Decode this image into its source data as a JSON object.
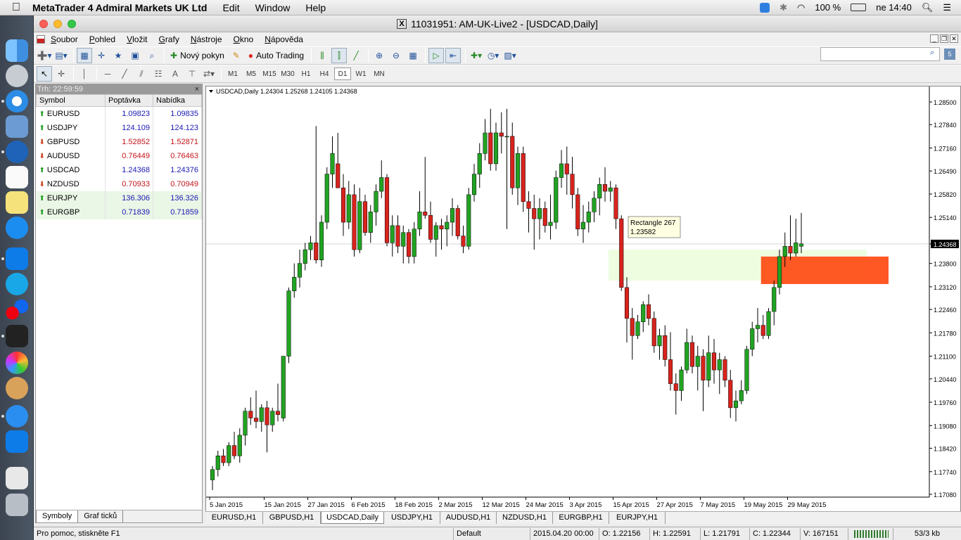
{
  "menubar": {
    "app_name": "MetaTrader 4 Admiral Markets UK Ltd",
    "items": [
      "Edit",
      "Window",
      "Help"
    ],
    "battery": "100 %",
    "clock": "ne 14:40"
  },
  "window": {
    "title": "11031951: AM-UK-Live2 - [USDCAD,Daily]"
  },
  "menu": {
    "items": [
      {
        "u": "S",
        "rest": "oubor"
      },
      {
        "u": "P",
        "rest": "ohled"
      },
      {
        "u": "V",
        "rest": "ložit"
      },
      {
        "u": "G",
        "rest": "rafy"
      },
      {
        "u": "N",
        "rest": "ástroje"
      },
      {
        "u": "O",
        "rest": "kno"
      },
      {
        "u": "N",
        "rest": "ápověda"
      }
    ]
  },
  "toolbar": {
    "new_order": "Nový pokyn",
    "auto_trading": "Auto Trading",
    "search_placeholder": "",
    "search_badge": "5"
  },
  "drawing_toolbar": {
    "timeframes": [
      "M1",
      "M5",
      "M15",
      "M30",
      "H1",
      "H4",
      "D1",
      "W1",
      "MN"
    ],
    "active": "D1",
    "text_tool": "A"
  },
  "market_watch": {
    "header": "Trh: 22:59:59",
    "columns": [
      "Symbol",
      "Poptávka",
      "Nabídka"
    ],
    "rows": [
      {
        "symbol": "EURUSD",
        "bid": "1.09823",
        "ask": "1.09835",
        "dir": "up",
        "color": "blue"
      },
      {
        "symbol": "USDJPY",
        "bid": "124.109",
        "ask": "124.123",
        "dir": "up",
        "color": "blue"
      },
      {
        "symbol": "GBPUSD",
        "bid": "1.52852",
        "ask": "1.52871",
        "dir": "down",
        "color": "red"
      },
      {
        "symbol": "AUDUSD",
        "bid": "0.76449",
        "ask": "0.76463",
        "dir": "down",
        "color": "red"
      },
      {
        "symbol": "USDCAD",
        "bid": "1.24368",
        "ask": "1.24376",
        "dir": "up",
        "color": "blue"
      },
      {
        "symbol": "NZDUSD",
        "bid": "0.70933",
        "ask": "0.70949",
        "dir": "down",
        "color": "red"
      },
      {
        "symbol": "EURJPY",
        "bid": "136.306",
        "ask": "136.326",
        "dir": "up",
        "color": "blue"
      },
      {
        "symbol": "EURGBP",
        "bid": "0.71839",
        "ask": "0.71859",
        "dir": "up",
        "color": "blue"
      }
    ],
    "tabs": [
      "Symboly",
      "Graf ticků"
    ]
  },
  "chart_data": {
    "type": "candlestick",
    "symbol": "USDCAD,Daily",
    "info": "USDCAD,Daily  1.24304 1.25268 1.24105 1.24368",
    "y_ticks": [
      "1.28500",
      "1.27840",
      "1.27160",
      "1.26490",
      "1.25820",
      "1.25140",
      "1.24368",
      "1.23800",
      "1.23120",
      "1.22460",
      "1.21780",
      "1.21100",
      "1.20440",
      "1.19760",
      "1.19080",
      "1.18420",
      "1.17740",
      "1.17080"
    ],
    "ylim": [
      1.1708,
      1.285
    ],
    "current_price": "1.24368",
    "x_labels": [
      "5 Jan 2015",
      "15 Jan 2015",
      "27 Jan 2015",
      "6 Feb 2015",
      "18 Feb 2015",
      "2 Mar 2015",
      "12 Mar 2015",
      "24 Mar 2015",
      "3 Apr 2015",
      "15 Apr 2015",
      "27 Apr 2015",
      "7 May 2015",
      "19 May 2015",
      "29 May 2015"
    ],
    "x_label_index": [
      0,
      10,
      18,
      26,
      34,
      42,
      50,
      58,
      66,
      74,
      82,
      90,
      98,
      106
    ],
    "candles": [
      [
        1.175,
        1.179,
        1.172,
        1.178
      ],
      [
        1.178,
        1.1835,
        1.176,
        1.182
      ],
      [
        1.182,
        1.184,
        1.179,
        1.18
      ],
      [
        1.18,
        1.186,
        1.179,
        1.185
      ],
      [
        1.185,
        1.189,
        1.181,
        1.182
      ],
      [
        1.182,
        1.19,
        1.18,
        1.188
      ],
      [
        1.188,
        1.196,
        1.185,
        1.195
      ],
      [
        1.195,
        1.199,
        1.191,
        1.193
      ],
      [
        1.193,
        1.201,
        1.19,
        1.192
      ],
      [
        1.192,
        1.197,
        1.189,
        1.196
      ],
      [
        1.196,
        1.198,
        1.183,
        1.191
      ],
      [
        1.191,
        1.196,
        1.189,
        1.195
      ],
      [
        1.195,
        1.203,
        1.192,
        1.194
      ],
      [
        1.193,
        1.21,
        1.192,
        1.211
      ],
      [
        1.211,
        1.231,
        1.209,
        1.23
      ],
      [
        1.23,
        1.238,
        1.228,
        1.234
      ],
      [
        1.234,
        1.242,
        1.231,
        1.238
      ],
      [
        1.238,
        1.244,
        1.236,
        1.242
      ],
      [
        1.242,
        1.246,
        1.239,
        1.244
      ],
      [
        1.244,
        1.278,
        1.238,
        1.239
      ],
      [
        1.239,
        1.252,
        1.237,
        1.25
      ],
      [
        1.25,
        1.266,
        1.248,
        1.264
      ],
      [
        1.264,
        1.275,
        1.26,
        1.27
      ],
      [
        1.267,
        1.276,
        1.26,
        1.26
      ],
      [
        1.26,
        1.264,
        1.246,
        1.25
      ],
      [
        1.25,
        1.262,
        1.248,
        1.258
      ],
      [
        1.258,
        1.261,
        1.24,
        1.242
      ],
      [
        1.242,
        1.26,
        1.241,
        1.256
      ],
      [
        1.256,
        1.258,
        1.246,
        1.247
      ],
      [
        1.247,
        1.255,
        1.244,
        1.253
      ],
      [
        1.253,
        1.261,
        1.249,
        1.259
      ],
      [
        1.259,
        1.268,
        1.257,
        1.263
      ],
      [
        1.263,
        1.264,
        1.243,
        1.244
      ],
      [
        1.244,
        1.252,
        1.24,
        1.249
      ],
      [
        1.249,
        1.252,
        1.241,
        1.243
      ],
      [
        1.243,
        1.249,
        1.238,
        1.247
      ],
      [
        1.247,
        1.248,
        1.238,
        1.24
      ],
      [
        1.24,
        1.25,
        1.238,
        1.248
      ],
      [
        1.248,
        1.259,
        1.246,
        1.253
      ],
      [
        1.253,
        1.269,
        1.251,
        1.252
      ],
      [
        1.252,
        1.256,
        1.244,
        1.245
      ],
      [
        1.245,
        1.25,
        1.24,
        1.249
      ],
      [
        1.249,
        1.251,
        1.242,
        1.248
      ],
      [
        1.248,
        1.252,
        1.243,
        1.25
      ],
      [
        1.25,
        1.257,
        1.246,
        1.254
      ],
      [
        1.254,
        1.255,
        1.245,
        1.246
      ],
      [
        1.246,
        1.249,
        1.241,
        1.243
      ],
      [
        1.243,
        1.26,
        1.242,
        1.258
      ],
      [
        1.258,
        1.267,
        1.256,
        1.264
      ],
      [
        1.264,
        1.273,
        1.26,
        1.27
      ],
      [
        1.27,
        1.28,
        1.268,
        1.276
      ],
      [
        1.276,
        1.283,
        1.265,
        1.267
      ],
      [
        1.267,
        1.279,
        1.265,
        1.276
      ],
      [
        1.276,
        1.282,
        1.27,
        1.275
      ],
      [
        1.275,
        1.283,
        1.248,
        1.275
      ],
      [
        1.275,
        1.279,
        1.258,
        1.26
      ],
      [
        1.26,
        1.272,
        1.255,
        1.27
      ],
      [
        1.27,
        1.272,
        1.253,
        1.256
      ],
      [
        1.256,
        1.259,
        1.247,
        1.254
      ],
      [
        1.254,
        1.258,
        1.242,
        1.251
      ],
      [
        1.251,
        1.257,
        1.245,
        1.254
      ],
      [
        1.254,
        1.256,
        1.247,
        1.249
      ],
      [
        1.249,
        1.258,
        1.245,
        1.25
      ],
      [
        1.25,
        1.265,
        1.248,
        1.263
      ],
      [
        1.263,
        1.271,
        1.26,
        1.267
      ],
      [
        1.267,
        1.272,
        1.258,
        1.264
      ],
      [
        1.264,
        1.269,
        1.254,
        1.258
      ],
      [
        1.258,
        1.26,
        1.246,
        1.248
      ],
      [
        1.248,
        1.255,
        1.244,
        1.25
      ],
      [
        1.25,
        1.256,
        1.247,
        1.253
      ],
      [
        1.253,
        1.259,
        1.25,
        1.257
      ],
      [
        1.257,
        1.263,
        1.252,
        1.261
      ],
      [
        1.261,
        1.266,
        1.256,
        1.259
      ],
      [
        1.259,
        1.262,
        1.256,
        1.26
      ],
      [
        1.26,
        1.261,
        1.248,
        1.251
      ],
      [
        1.251,
        1.252,
        1.23,
        1.231
      ],
      [
        1.231,
        1.234,
        1.215,
        1.222
      ],
      [
        1.222,
        1.225,
        1.21,
        1.217
      ],
      [
        1.217,
        1.223,
        1.216,
        1.221
      ],
      [
        1.221,
        1.227,
        1.218,
        1.226
      ],
      [
        1.226,
        1.229,
        1.22,
        1.222
      ],
      [
        1.222,
        1.224,
        1.212,
        1.214
      ],
      [
        1.214,
        1.219,
        1.21,
        1.217
      ],
      [
        1.217,
        1.22,
        1.208,
        1.21
      ],
      [
        1.21,
        1.218,
        1.201,
        1.203
      ],
      [
        1.203,
        1.206,
        1.194,
        1.201
      ],
      [
        1.201,
        1.208,
        1.198,
        1.207
      ],
      [
        1.207,
        1.219,
        1.206,
        1.215
      ],
      [
        1.215,
        1.217,
        1.206,
        1.208
      ],
      [
        1.208,
        1.214,
        1.201,
        1.211
      ],
      [
        1.211,
        1.213,
        1.195,
        1.204
      ],
      [
        1.204,
        1.217,
        1.202,
        1.212
      ],
      [
        1.212,
        1.216,
        1.203,
        1.207
      ],
      [
        1.207,
        1.212,
        1.2,
        1.21
      ],
      [
        1.21,
        1.211,
        1.202,
        1.204
      ],
      [
        1.204,
        1.207,
        1.193,
        1.196
      ],
      [
        1.196,
        1.201,
        1.192,
        1.198
      ],
      [
        1.198,
        1.204,
        1.197,
        1.201
      ],
      [
        1.201,
        1.214,
        1.2,
        1.213
      ],
      [
        1.213,
        1.221,
        1.211,
        1.219
      ],
      [
        1.219,
        1.225,
        1.215,
        1.22
      ],
      [
        1.22,
        1.223,
        1.216,
        1.217
      ],
      [
        1.217,
        1.225,
        1.216,
        1.224
      ],
      [
        1.224,
        1.233,
        1.22,
        1.231
      ],
      [
        1.231,
        1.242,
        1.229,
        1.24
      ],
      [
        1.24,
        1.247,
        1.237,
        1.243
      ],
      [
        1.243,
        1.252,
        1.239,
        1.241
      ],
      [
        1.241,
        1.251,
        1.24,
        1.244
      ],
      [
        1.243,
        1.2527,
        1.241,
        1.2437
      ]
    ],
    "zones": [
      {
        "label": "light-green zone",
        "x_from_index": 73,
        "x_to_index": 120,
        "y_top": 1.242,
        "y_bottom": 1.233,
        "color": "#eefde0"
      },
      {
        "label": "orange zone",
        "x_from_index": 101,
        "x_to_index": 124,
        "y_top": 1.24,
        "y_bottom": 1.232,
        "color": "#ff4a12"
      }
    ],
    "tooltip": {
      "name": "Rectangle 267",
      "price": "1.23582"
    },
    "up_color": "#22a322",
    "down_color": "#d8231d"
  },
  "chart_tabs": [
    "EURUSD,H1",
    "GBPUSD,H1",
    "USDCAD,Daily",
    "USDJPY,H1",
    "AUDUSD,H1",
    "NZDUSD,H1",
    "EURGBP,H1",
    "EURJPY,H1"
  ],
  "chart_tab_active": "USDCAD,Daily",
  "status": {
    "help": "Pro pomoc, stiskněte F1",
    "profile": "Default",
    "time": "2015.04.20 00:00",
    "open": "O: 1.22156",
    "high": "H: 1.22591",
    "low": "L: 1.21791",
    "close": "C: 1.22344",
    "volume": "V: 167151",
    "traffic": "53/3 kb"
  }
}
